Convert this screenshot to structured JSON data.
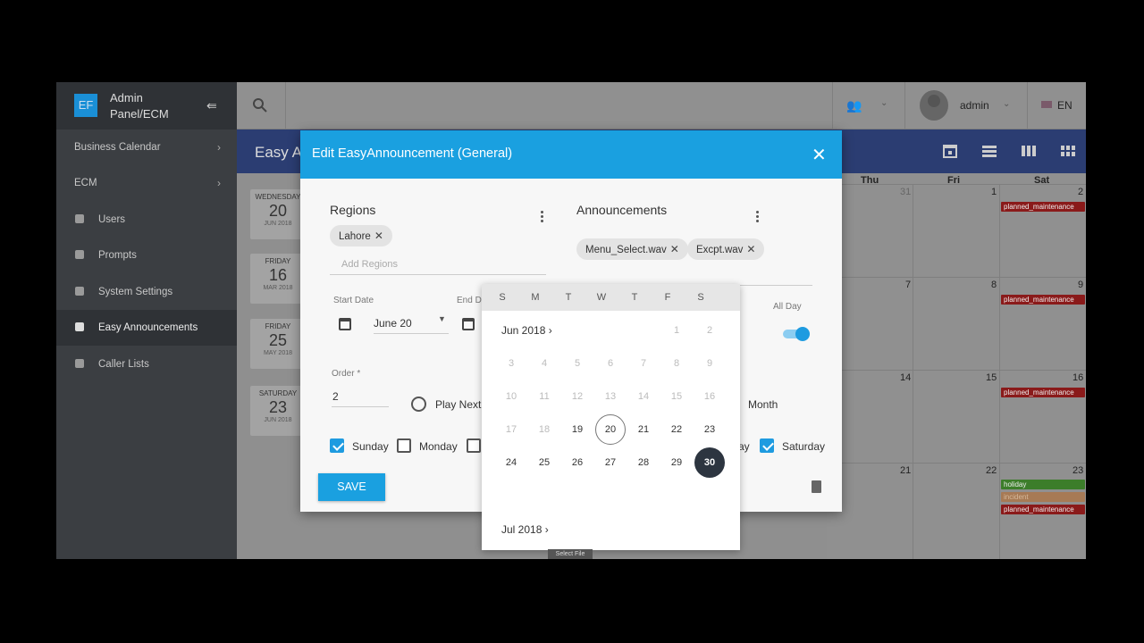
{
  "brand": {
    "logo": "EF",
    "title": "Admin Panel/ECM"
  },
  "sidebar": {
    "items": [
      {
        "label": "Business Calendar",
        "group": true
      },
      {
        "label": "ECM",
        "group": true
      },
      {
        "label": "Users",
        "icon": "user-icon"
      },
      {
        "label": "Prompts",
        "icon": "prompt-icon"
      },
      {
        "label": "System Settings",
        "icon": "gear-icon"
      },
      {
        "label": "Easy Announcements",
        "icon": "calendar-icon",
        "active": true
      },
      {
        "label": "Caller Lists",
        "icon": "list-icon"
      }
    ]
  },
  "topbar": {
    "user": "admin",
    "language": "EN"
  },
  "page": {
    "title": "Easy A"
  },
  "list_days": [
    {
      "dow": "WEDNESDAY",
      "num": "20",
      "md": "JUN 2018"
    },
    {
      "dow": "FRIDAY",
      "num": "16",
      "md": "MAR 2018"
    },
    {
      "dow": "FRIDAY",
      "num": "25",
      "md": "MAY 2018"
    },
    {
      "dow": "SATURDAY",
      "num": "23",
      "md": "JUN 2018"
    }
  ],
  "calendar": {
    "headers": [
      "Thu",
      "Fri",
      "Sat"
    ],
    "rows": [
      {
        "nums": [
          "31",
          "1",
          "2"
        ]
      },
      {
        "nums": [
          "7",
          "8",
          "9"
        ]
      },
      {
        "nums": [
          "14",
          "15",
          "16"
        ]
      },
      {
        "nums": [
          "21",
          "22",
          "23"
        ]
      }
    ],
    "events": {
      "maint": "planned_maintenance",
      "holiday": "holiday",
      "incident": "incident"
    }
  },
  "dialog": {
    "title": "Edit EasyAnnouncement (General)",
    "close": "✕",
    "regions_title": "Regions",
    "regions_chip": "Lahore",
    "regions_placeholder": "Add Regions",
    "announcements_title": "Announcements",
    "announcement_chips": [
      "Menu_Select.wav",
      "Excpt.wav"
    ],
    "start_date_label": "Start Date",
    "start_date_value": "June 20",
    "end_date_label": "End D",
    "all_day_label": "All Day",
    "order_label": "Order *",
    "order_value": "2",
    "play_next_label": "Play Next",
    "month_label": "Month",
    "days": {
      "sunday": "Sunday",
      "monday": "Monday",
      "saturday_partial": "ay",
      "saturday": "Saturday"
    },
    "save_label": "SAVE"
  },
  "picker": {
    "weekdays": [
      "S",
      "M",
      "T",
      "W",
      "T",
      "F",
      "S"
    ],
    "month1": "Jun 2018",
    "month2": "Jul 2018",
    "weeks": [
      [
        "",
        "",
        "",
        "",
        "",
        "1",
        "2"
      ],
      [
        "3",
        "4",
        "5",
        "6",
        "7",
        "8",
        "9"
      ],
      [
        "10",
        "11",
        "12",
        "13",
        "14",
        "15",
        "16"
      ],
      [
        "17",
        "18",
        "19",
        "20",
        "21",
        "22",
        "23"
      ],
      [
        "24",
        "25",
        "26",
        "27",
        "28",
        "29",
        "30"
      ]
    ],
    "first_enabled": "19",
    "today": "20",
    "selected": "30"
  },
  "select_file_label": "Select File",
  "colors": {
    "accent": "#1aa0e0",
    "sidebar": "#3b3e42",
    "selected_day": "#2d3540"
  }
}
